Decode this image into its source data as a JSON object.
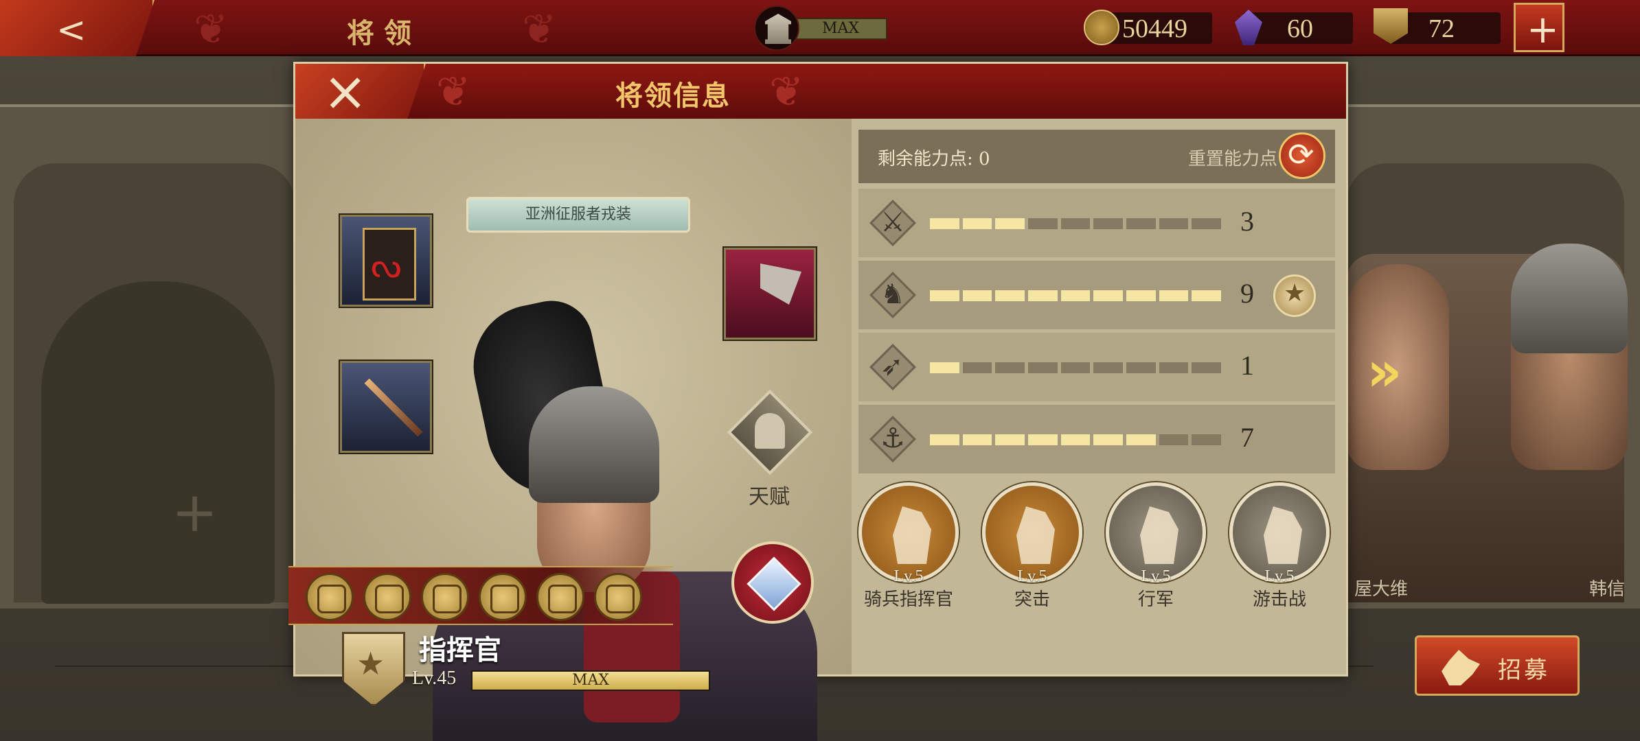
{
  "topbar": {
    "title": "将领",
    "building_level": "MAX",
    "coins": "50449",
    "gems": "60",
    "tokens": "72"
  },
  "modal": {
    "title": "将领信息",
    "skin_name": "亚洲征服者戎装",
    "talent_label": "天赋",
    "rank_title": "指挥官",
    "level": "Lv.45",
    "xp_label": "MAX",
    "xp_progress": 1.0
  },
  "stats": {
    "remaining_points": "剩余能力点: 0",
    "reset_label": "重置能力点",
    "rows": [
      {
        "icon": "sword-icon",
        "value": "3",
        "max": 9
      },
      {
        "icon": "horse-icon",
        "value": "9",
        "max": 9
      },
      {
        "icon": "bow-icon",
        "value": "1",
        "max": 9
      },
      {
        "icon": "anchor-icon",
        "value": "7",
        "max": 9
      }
    ]
  },
  "traits": [
    {
      "level": "Lv.5",
      "name": "骑兵指挥官",
      "style": "gold"
    },
    {
      "level": "Lv.5",
      "name": "突击",
      "style": "gold"
    },
    {
      "level": "Lv.5",
      "name": "行军",
      "style": "grey"
    },
    {
      "level": "Lv.5",
      "name": "游击战",
      "style": "grey"
    }
  ],
  "side": {
    "left_name": "屋大维",
    "right_name": "韩信"
  },
  "recruit_label": "招募"
}
